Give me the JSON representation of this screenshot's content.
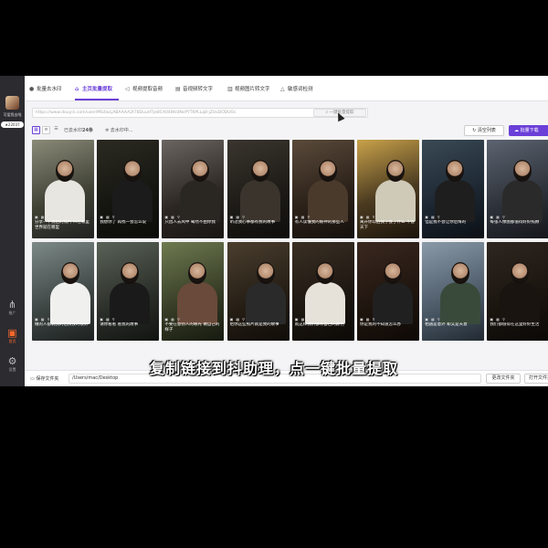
{
  "sidebar": {
    "username": "可爱我去啦",
    "badge": "★22037",
    "items": [
      {
        "label": "推广",
        "icon": "share-icon"
      },
      {
        "label": "首页",
        "icon": "home-bag-icon"
      },
      {
        "label": "设置",
        "icon": "gear-icon"
      }
    ]
  },
  "tabs": [
    {
      "label": "批量去水印",
      "icon": "play-circle-icon"
    },
    {
      "label": "主页批量提取",
      "icon": "home-icon"
    },
    {
      "label": "视频提取音频",
      "icon": "audio-icon"
    },
    {
      "label": "音视频转文字",
      "icon": "text-icon"
    },
    {
      "label": "视频图片转文字",
      "icon": "image-icon"
    },
    {
      "label": "敏感词检测",
      "icon": "warning-icon"
    }
  ],
  "url_input": {
    "value": "https://www.douyin.com/user/MS4wLjABAAAA2t78DuuHTje8CA04Ws0NvPYTKPLLq8-jZUxDODUOc",
    "extract_label": "一键批量提取"
  },
  "toolbar": {
    "count_label": "已去水印",
    "count_value": "24条",
    "status": "去水印中...",
    "clear_label": "清空列表",
    "download_label": "批量下载"
  },
  "cards": [
    {
      "caption": "分享一下我拍的照片 人在哪里 世界就在哪里"
    },
    {
      "caption": "我想你了 再找一会怎么说"
    },
    {
      "caption": "只因人去风中 蓦然不由你我"
    },
    {
      "caption": "听过我心事都有我的故事"
    },
    {
      "caption": "有人读懂我的眼神的那些人"
    },
    {
      "caption": "离开你以后我学会了什么 不会天下"
    },
    {
      "caption": "但是我不会让你后悔的"
    },
    {
      "caption": "每张人像图都值得好好照顾"
    },
    {
      "caption": "做的人都说我的拍照技巧很好"
    },
    {
      "caption": "请你看看 看我的故事"
    },
    {
      "caption": "不要在意别人的眼光 做自己的样子"
    },
    {
      "caption": "给你这些照片就是我的故事"
    },
    {
      "caption": "就这样我们都有自己的颜色"
    },
    {
      "caption": "你是我的不知道怎么办"
    },
    {
      "caption": "相遇是意外 却又是天意"
    },
    {
      "caption": "我们都值得在这里好好生活"
    }
  ],
  "bottom": {
    "save_label": "保存文件夹",
    "path": "/Users/mac/Desktop",
    "change_label": "更改文件夹",
    "open_label": "打开文件夹"
  },
  "subtitle": "复制链接到抖助理，点一键批量提取"
}
